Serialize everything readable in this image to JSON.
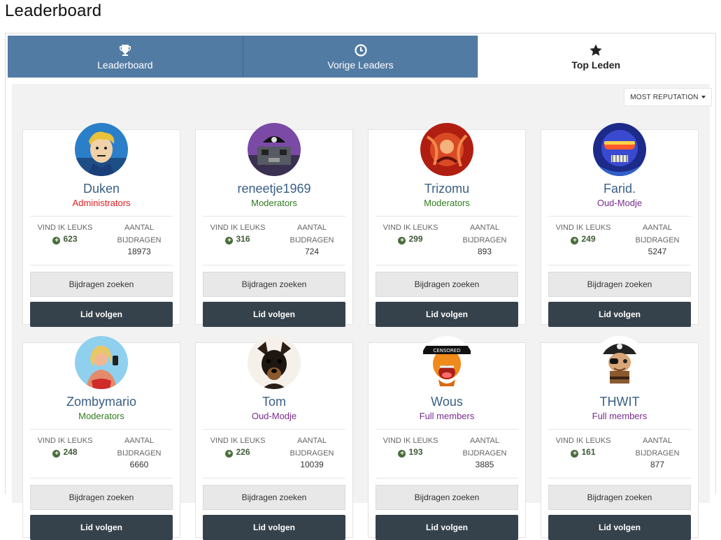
{
  "page_title": "Leaderboard",
  "tabs": [
    {
      "label": "Leaderboard",
      "icon": "trophy-icon",
      "active": false
    },
    {
      "label": "Vorige Leaders",
      "icon": "clock-icon",
      "active": false
    },
    {
      "label": "Top Leden",
      "icon": "star-icon",
      "active": true
    }
  ],
  "sort": {
    "label": "MOST REPUTATION"
  },
  "labels": {
    "likes": "VIND IK LEUKS",
    "posts_line1": "AANTAL",
    "posts_line2": "BIJDRAGEN",
    "search_button": "Bijdragen zoeken",
    "follow_button": "Lid volgen"
  },
  "colors": {
    "tab_bg": "#527ba3",
    "username": "#3a5f86",
    "administrators": "#e0201f",
    "moderators": "#2e7d1e",
    "oud_modje": "#7a2c8f",
    "full_members": "#7a2c8f",
    "follow_button": "#36424b",
    "likes_icon": "#4a6d3a"
  },
  "members": [
    {
      "name": "Duken",
      "group": "Administrators",
      "group_color": "#e0201f",
      "likes": "623",
      "posts": "18973",
      "avatar": "cartoon-boy-avatar"
    },
    {
      "name": "reneetje1969",
      "group": "Moderators",
      "group_color": "#2e7d1e",
      "likes": "316",
      "posts": "724",
      "avatar": "pirate-ship-avatar"
    },
    {
      "name": "Trizomu",
      "group": "Moderators",
      "group_color": "#2e7d1e",
      "likes": "299",
      "posts": "893",
      "avatar": "red-artwork-avatar"
    },
    {
      "name": "Farid.",
      "group": "Oud-Modje",
      "group_color": "#7a2c8f",
      "likes": "249",
      "posts": "5247",
      "avatar": "masked-rider-avatar"
    },
    {
      "name": "Zombymario",
      "group": "Moderators",
      "group_color": "#2e7d1e",
      "likes": "248",
      "posts": "6660",
      "avatar": "game-character-avatar"
    },
    {
      "name": "Tom",
      "group": "Oud-Modje",
      "group_color": "#7a2c8f",
      "likes": "226",
      "posts": "10039",
      "avatar": "dog-avatar"
    },
    {
      "name": "Wous",
      "group": "Full members",
      "group_color": "#7a2c8f",
      "likes": "193",
      "posts": "3885",
      "avatar": "censored-smiley-avatar",
      "avatar_text": "CENSORED"
    },
    {
      "name": "THWIT",
      "group": "Full members",
      "group_color": "#7a2c8f",
      "likes": "161",
      "posts": "877",
      "avatar": "pirate-smiley-avatar"
    }
  ]
}
